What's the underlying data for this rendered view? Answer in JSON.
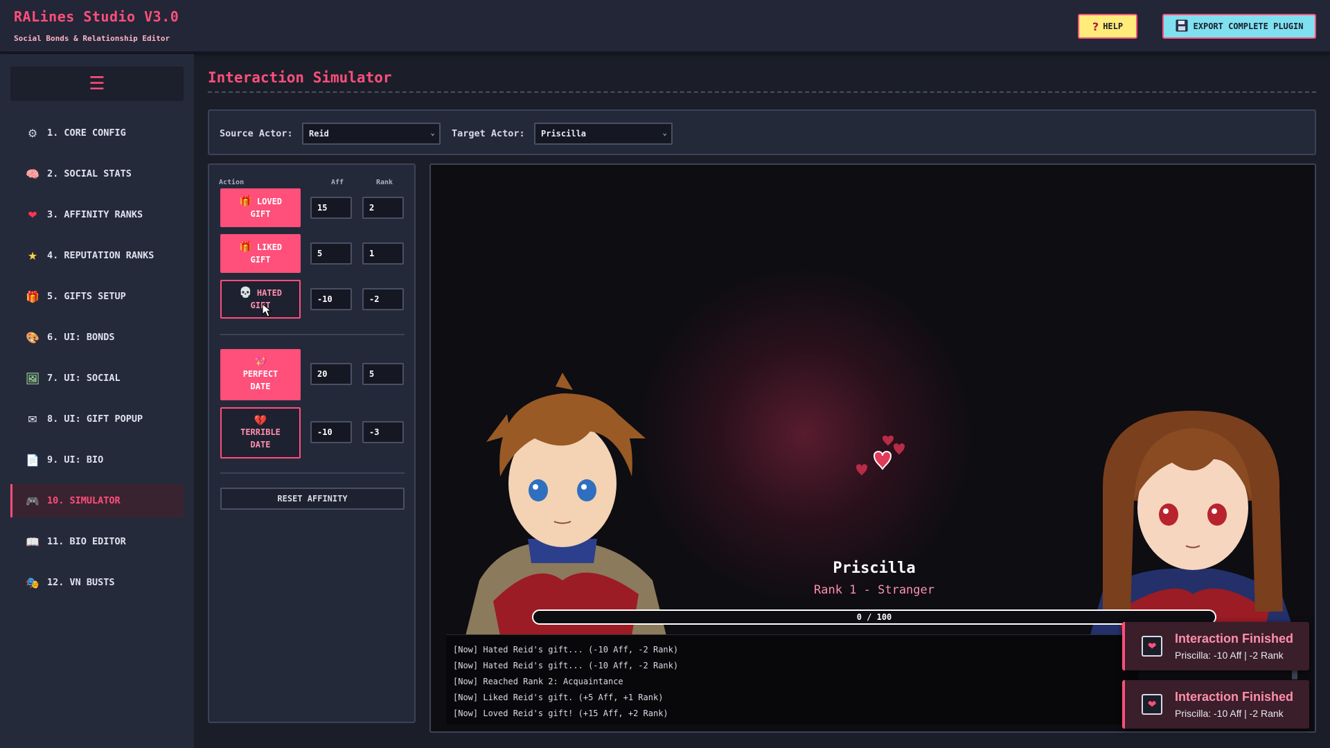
{
  "app": {
    "title": "RALines Studio V3.0",
    "subtitle": "Social Bonds & Relationship Editor"
  },
  "header": {
    "help_label": "HELP",
    "export_label": "EXPORT COMPLETE PLUGIN",
    "help_icon": "question-icon",
    "export_icon": "floppy-disk-icon"
  },
  "sidebar": {
    "menu_icon": "hamburger-icon",
    "items": [
      {
        "label": "1. CORE CONFIG",
        "icon": "⚙"
      },
      {
        "label": "2. SOCIAL STATS",
        "icon": "🧠"
      },
      {
        "label": "3. AFFINITY RANKS",
        "icon": "❤"
      },
      {
        "label": "4. REPUTATION RANKS",
        "icon": "★"
      },
      {
        "label": "5. GIFTS SETUP",
        "icon": "🎁"
      },
      {
        "label": "6. UI: BONDS",
        "icon": "🎨"
      },
      {
        "label": "7. UI: SOCIAL",
        "icon": "🖼"
      },
      {
        "label": "8. UI: GIFT POPUP",
        "icon": "✉"
      },
      {
        "label": "9. UI: BIO",
        "icon": "📄"
      },
      {
        "label": "10. SIMULATOR",
        "icon": "🎮",
        "active": true
      },
      {
        "label": "11. BIO EDITOR",
        "icon": "📖"
      },
      {
        "label": "12. VN BUSTS",
        "icon": "🎭"
      }
    ]
  },
  "main": {
    "title": "Interaction Simulator",
    "source_label": "Source Actor:",
    "source_value": "Reid",
    "target_label": "Target Actor:",
    "target_value": "Priscilla"
  },
  "actions": {
    "col_action": "Action",
    "col_aff": "Aff",
    "col_rank": "Rank",
    "loved_gift": {
      "label_1": "LOVED",
      "label_2": "GIFT",
      "icon": "🎁",
      "aff": "15",
      "rank": "2"
    },
    "liked_gift": {
      "label_1": "LIKED",
      "label_2": "GIFT",
      "icon": "🎁",
      "aff": "5",
      "rank": "1"
    },
    "hated_gift": {
      "label_1": "HATED",
      "label_2": "GIFT",
      "icon": "💀",
      "aff": "-10",
      "rank": "-2"
    },
    "perfect_date": {
      "label_1": "PERFECT",
      "label_2": "DATE",
      "icon": "💖",
      "aff": "20",
      "rank": "5"
    },
    "terrible_date": {
      "label_1": "TERRIBLE",
      "label_2": "DATE",
      "icon": "💔",
      "aff": "-10",
      "rank": "-3"
    },
    "reset_label": "RESET AFFINITY"
  },
  "stage": {
    "target_name": "Priscilla",
    "target_rank": "Rank 1 - Stranger",
    "affinity_text": "0 / 100",
    "affinity_fraction": 0,
    "log": [
      "[Now] Hated Reid's gift... (-10 Aff, -2 Rank)",
      "[Now] Hated Reid's gift... (-10 Aff, -2 Rank)",
      "[Now] Reached Rank 2: Acquaintance",
      "[Now] Liked Reid's gift. (+5 Aff, +1 Rank)",
      "[Now] Loved Reid's gift! (+15 Aff, +2 Rank)"
    ]
  },
  "toasts": [
    {
      "title": "Interaction Finished",
      "message": "Priscilla: -10 Aff | -2 Rank"
    },
    {
      "title": "Interaction Finished",
      "message": "Priscilla: -10 Aff | -2 Rank"
    }
  ],
  "colors": {
    "accent": "#ff4f7b",
    "background": "#1b1e29",
    "panel": "#242939",
    "help_button": "#ffec7a",
    "export_button": "#7fe0f0"
  }
}
